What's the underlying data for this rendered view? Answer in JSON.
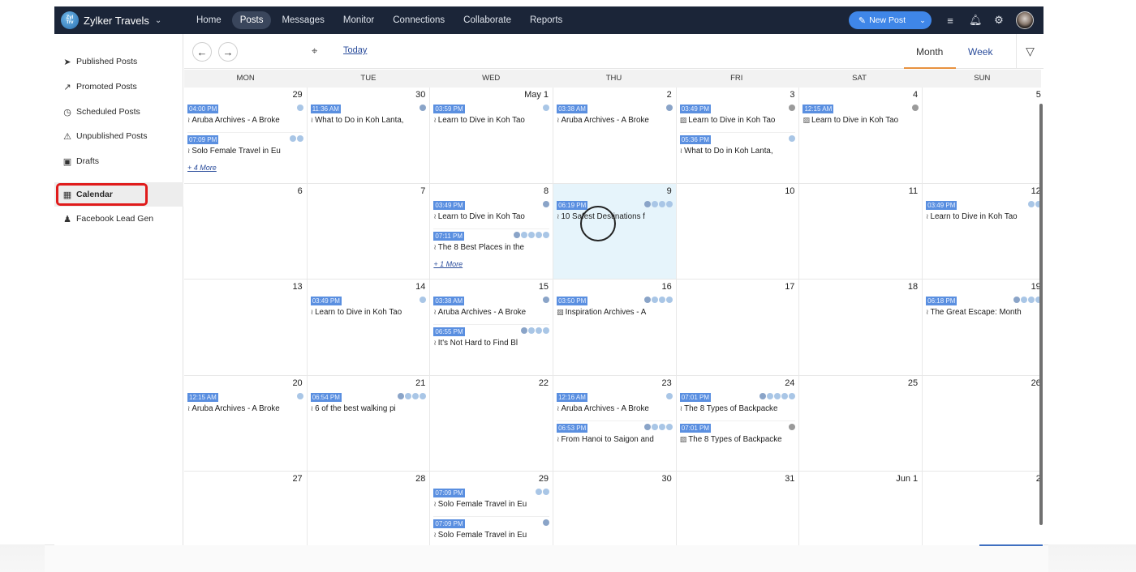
{
  "app": {
    "brand": "Zylker Travels",
    "brand_logo_text": "Zylker Travels",
    "nav": [
      "Home",
      "Posts",
      "Messages",
      "Monitor",
      "Connections",
      "Collaborate",
      "Reports"
    ],
    "active_nav": "Posts",
    "new_post_label": "New Post",
    "icons": [
      "list-icon",
      "bell-icon",
      "gear-icon",
      "avatar"
    ]
  },
  "sidebar": {
    "items": [
      {
        "label": "Published Posts",
        "icon": "paper-plane-icon"
      },
      {
        "label": "Promoted Posts",
        "icon": "promote-arrow-icon"
      },
      {
        "label": "Scheduled Posts",
        "icon": "clock-icon"
      },
      {
        "label": "Unpublished Posts",
        "icon": "warning-icon"
      },
      {
        "label": "Drafts",
        "icon": "drafts-icon"
      },
      {
        "label": "Calendar",
        "icon": "calendar-icon",
        "active": true
      },
      {
        "label": "Facebook Lead Gen",
        "icon": "lead-gen-icon"
      }
    ]
  },
  "toolbar": {
    "today_label": "Today",
    "views": [
      "Month",
      "Week"
    ],
    "active_view": "Month"
  },
  "calendar": {
    "weekdays": [
      "MON",
      "TUE",
      "WED",
      "THU",
      "FRI",
      "SAT",
      "SUN"
    ],
    "highlight_day": "9",
    "weeks": [
      [
        {
          "num": "29",
          "posts": [
            {
              "time": "04:00 PM",
              "title": "Aruba Archives - A Broke",
              "type": "link",
              "nets": [
                "tw"
              ]
            },
            {
              "time": "07:09 PM",
              "title": "Solo Female Travel in Eu",
              "type": "link",
              "nets": [
                "tw",
                "ig"
              ]
            }
          ],
          "more": "+ 4 More"
        },
        {
          "num": "30",
          "posts": [
            {
              "time": "11:36 AM",
              "title": "What to Do in Koh Lanta,",
              "type": "link",
              "nets": [
                "fb"
              ]
            }
          ]
        },
        {
          "num": "May 1",
          "posts": [
            {
              "time": "03:59 PM",
              "title": "Learn to Dive in Koh Tao",
              "type": "link",
              "nets": [
                "ig"
              ]
            }
          ]
        },
        {
          "num": "2",
          "posts": [
            {
              "time": "03:38 AM",
              "title": "Aruba Archives - A Broke",
              "type": "link",
              "nets": [
                "fb"
              ]
            }
          ]
        },
        {
          "num": "3",
          "posts": [
            {
              "time": "03:49 PM",
              "title": "Learn to Dive in Koh Tao",
              "type": "image",
              "nets": [
                "grey"
              ]
            },
            {
              "time": "05:36 PM",
              "title": "What to Do in Koh Lanta,",
              "type": "link",
              "nets": [
                "tw"
              ]
            }
          ]
        },
        {
          "num": "4",
          "posts": [
            {
              "time": "12:15 AM",
              "title": "Learn to Dive in Koh Tao",
              "type": "image",
              "nets": [
                "grey"
              ]
            }
          ]
        },
        {
          "num": "5",
          "posts": []
        }
      ],
      [
        {
          "num": "6",
          "posts": []
        },
        {
          "num": "7",
          "posts": []
        },
        {
          "num": "8",
          "posts": [
            {
              "time": "03:49 PM",
              "title": "Learn to Dive in Koh Tao",
              "type": "link",
              "nets": [
                "fb"
              ]
            },
            {
              "time": "07:11 PM",
              "title": "The 8 Best Places in the",
              "type": "link",
              "nets": [
                "fb",
                "tw",
                "li",
                "gp",
                "ig"
              ]
            }
          ],
          "more": "+ 1 More"
        },
        {
          "num": "9",
          "posts": [
            {
              "time": "06:19 PM",
              "title": "10 Safest Destinations f",
              "type": "link",
              "nets": [
                "fb",
                "tw",
                "li",
                "ig"
              ]
            }
          ]
        },
        {
          "num": "10",
          "posts": []
        },
        {
          "num": "11",
          "posts": []
        },
        {
          "num": "12",
          "posts": [
            {
              "time": "03:49 PM",
              "title": "Learn to Dive in Koh Tao",
              "type": "link",
              "nets": [
                "tw",
                "ig"
              ]
            }
          ]
        }
      ],
      [
        {
          "num": "13",
          "posts": []
        },
        {
          "num": "14",
          "posts": [
            {
              "time": "03:49 PM",
              "title": "Learn to Dive in Koh Tao",
              "type": "link",
              "nets": [
                "ig"
              ]
            }
          ]
        },
        {
          "num": "15",
          "posts": [
            {
              "time": "03:38 AM",
              "title": "Aruba Archives - A Broke",
              "type": "link",
              "nets": [
                "fb"
              ]
            },
            {
              "time": "06:55 PM",
              "title": "It's Not Hard to Find Bl",
              "type": "link",
              "nets": [
                "fb",
                "tw",
                "li",
                "ig"
              ]
            }
          ]
        },
        {
          "num": "16",
          "posts": [
            {
              "time": "03:50 PM",
              "title": "Inspiration Archives - A",
              "type": "image",
              "nets": [
                "fb",
                "tw",
                "li",
                "ig"
              ]
            }
          ]
        },
        {
          "num": "17",
          "posts": []
        },
        {
          "num": "18",
          "posts": []
        },
        {
          "num": "19",
          "posts": [
            {
              "time": "06:18 PM",
              "title": "The Great Escape: Month",
              "type": "link",
              "nets": [
                "fb",
                "tw",
                "li",
                "ig"
              ]
            }
          ]
        }
      ],
      [
        {
          "num": "20",
          "posts": [
            {
              "time": "12:15 AM",
              "title": "Aruba Archives - A Broke",
              "type": "link",
              "nets": [
                "ig"
              ]
            }
          ]
        },
        {
          "num": "21",
          "posts": [
            {
              "time": "06:54 PM",
              "title": "6 of the best walking pi",
              "type": "link",
              "nets": [
                "fb",
                "tw",
                "li",
                "ig"
              ]
            }
          ]
        },
        {
          "num": "22",
          "posts": []
        },
        {
          "num": "23",
          "posts": [
            {
              "time": "12:16 AM",
              "title": "Aruba Archives - A Broke",
              "type": "link",
              "nets": [
                "tw"
              ]
            },
            {
              "time": "06:53 PM",
              "title": "From Hanoi to Saigon and",
              "type": "link",
              "nets": [
                "fb",
                "tw",
                "li",
                "ig"
              ]
            }
          ]
        },
        {
          "num": "24",
          "posts": [
            {
              "time": "07:01 PM",
              "title": "The 8 Types of Backpacke",
              "type": "link",
              "nets": [
                "fb",
                "tw",
                "li",
                "gp",
                "ig"
              ]
            },
            {
              "time": "07:01 PM",
              "title": "The 8 Types of Backpacke",
              "type": "image",
              "nets": [
                "grey"
              ]
            }
          ]
        },
        {
          "num": "25",
          "posts": []
        },
        {
          "num": "26",
          "posts": []
        }
      ],
      [
        {
          "num": "27",
          "posts": []
        },
        {
          "num": "28",
          "posts": []
        },
        {
          "num": "29",
          "posts": [
            {
              "time": "07:09 PM",
              "title": "Solo Female Travel in Eu",
              "type": "link",
              "nets": [
                "tw",
                "ig"
              ]
            },
            {
              "time": "07:09 PM",
              "title": "Solo Female Travel in Eu",
              "type": "link",
              "nets": [
                "fb"
              ]
            }
          ]
        },
        {
          "num": "30",
          "posts": []
        },
        {
          "num": "31",
          "posts": []
        },
        {
          "num": "Jun 1",
          "posts": []
        },
        {
          "num": "2",
          "posts": []
        }
      ]
    ]
  }
}
